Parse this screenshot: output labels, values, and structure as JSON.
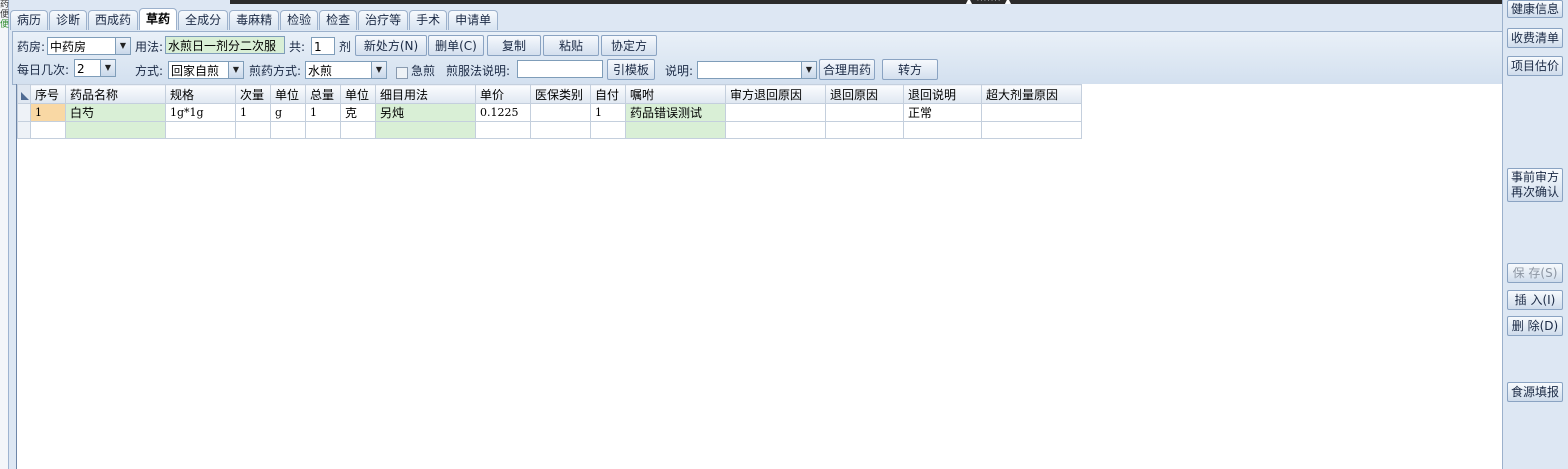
{
  "left_strip": [
    "药",
    "便",
    "便"
  ],
  "tabs": [
    "病历",
    "诊断",
    "西成药",
    "草药",
    "全成分",
    "毒麻精",
    "检验",
    "检查",
    "治疗等",
    "手术",
    "申请单"
  ],
  "active_tab": "草药",
  "toolbar": {
    "pharmacy_label": "药房:",
    "pharmacy_value": "中药房",
    "usage_label": "用法:",
    "usage_value": "水煎日一剂分二次服",
    "total_label": "共:",
    "total_value": "1",
    "total_unit": "剂",
    "new_rx_button": "新处方(N)",
    "delete_rx_button": "删单(C)",
    "copy_button": "复制",
    "paste_button": "粘贴",
    "agreement_rx_button": "协定方",
    "daily_times_label": "每日几次:",
    "daily_times_value": "2",
    "method_label": "方式:",
    "method_value": "回家自煎",
    "decoct_method_label": "煎药方式:",
    "decoct_method_value": "水煎",
    "urgent_label": "急煎",
    "pre_intake_label": "煎服法说明:",
    "pre_intake_value": "",
    "template_button": "引模板",
    "note_label": "说明:",
    "note_value": "",
    "rational_button": "合理用药",
    "transfer_button": "转方"
  },
  "grid": {
    "columns": [
      "序号",
      "药品名称",
      "规格",
      "次量",
      "单位",
      "总量",
      "单位",
      "细目用法",
      "单价",
      "医保类别",
      "自付",
      "嘱咐",
      "审方退回原因",
      "退回原因",
      "退回说明",
      "超大剂量原因"
    ],
    "rows": [
      [
        "1",
        "白芍",
        "1g*1g",
        "1",
        "g",
        "1",
        "克",
        "另炖",
        "0.1225",
        "",
        "1",
        "药品错误测试",
        "",
        "",
        "正常",
        ""
      ]
    ]
  },
  "right_panel": {
    "health_info": "健康信息",
    "fee_list": "收费清单",
    "estimate": "项目估价",
    "pre_review_1": "事前审方",
    "pre_review_2": "再次确认",
    "save": "保 存(S)",
    "insert": "插 入(I)",
    "delete": "删 除(D)",
    "food_report": "食源填报"
  }
}
